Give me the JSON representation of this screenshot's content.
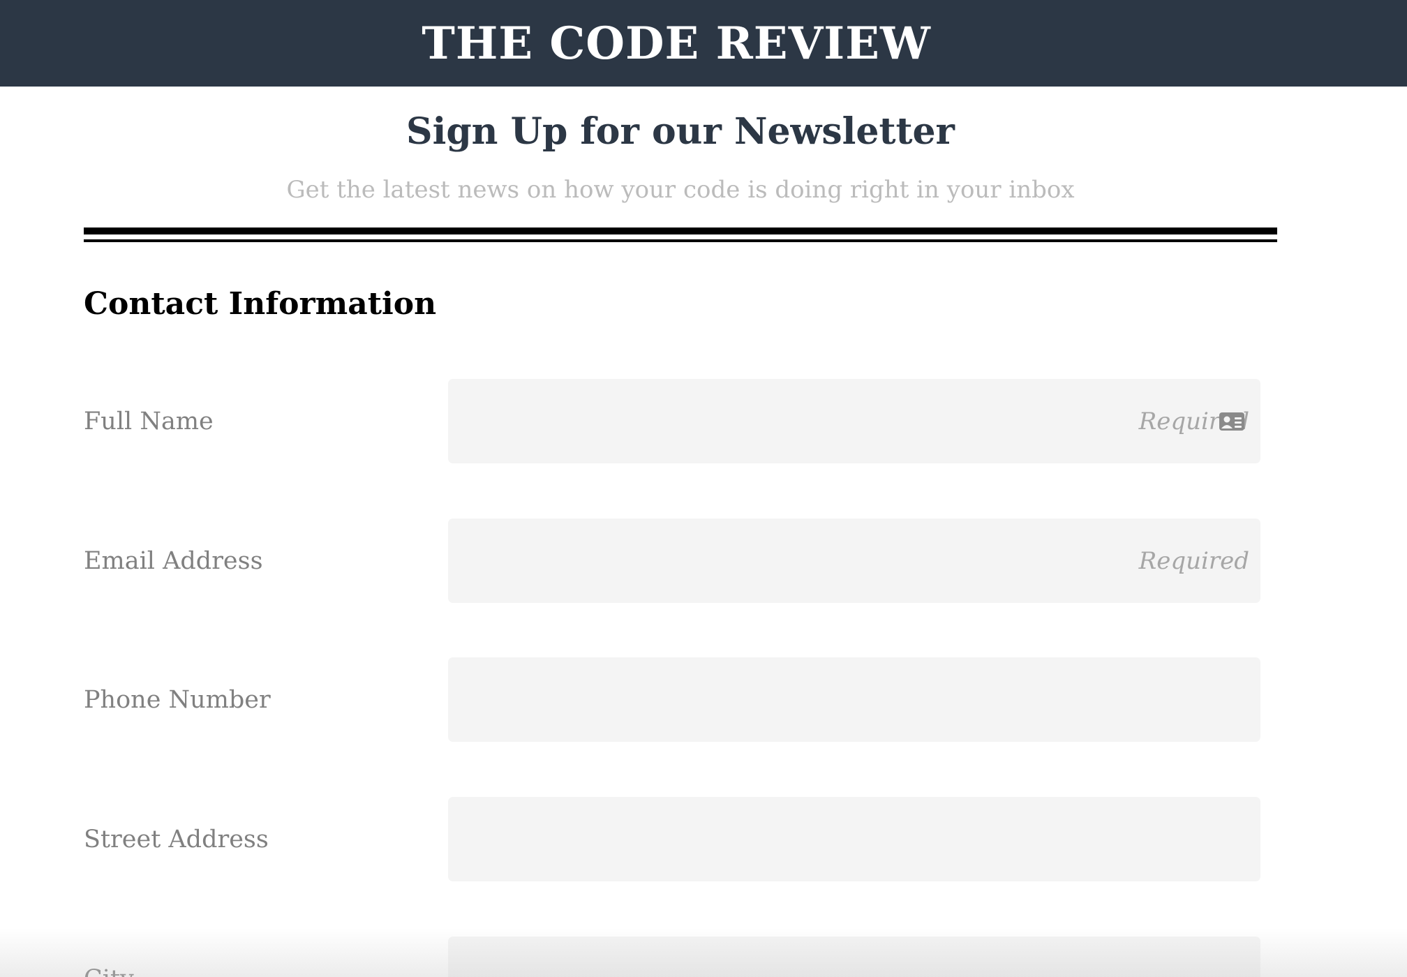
{
  "header": {
    "site_title": "THE CODE REVIEW"
  },
  "intro": {
    "title": "Sign Up for our Newsletter",
    "subtitle": "Get the latest news on how your code is doing right in your inbox"
  },
  "contact_section": {
    "heading": "Contact Information",
    "fields": [
      {
        "label": "Full Name",
        "placeholder": "Required",
        "value": "",
        "icon": "contact-card-icon"
      },
      {
        "label": "Email Address",
        "placeholder": "Required",
        "value": ""
      },
      {
        "label": "Phone Number",
        "placeholder": "",
        "value": ""
      },
      {
        "label": "Street Address",
        "placeholder": "",
        "value": ""
      },
      {
        "label": "City",
        "placeholder": "",
        "value": ""
      }
    ]
  },
  "colors": {
    "header_bg": "#2c3745",
    "title_text": "#2c3745",
    "subtitle_text": "#bbbbbb",
    "label_text": "#808080",
    "input_bg": "#f4f4f4",
    "placeholder_text": "#a6a6a6"
  }
}
